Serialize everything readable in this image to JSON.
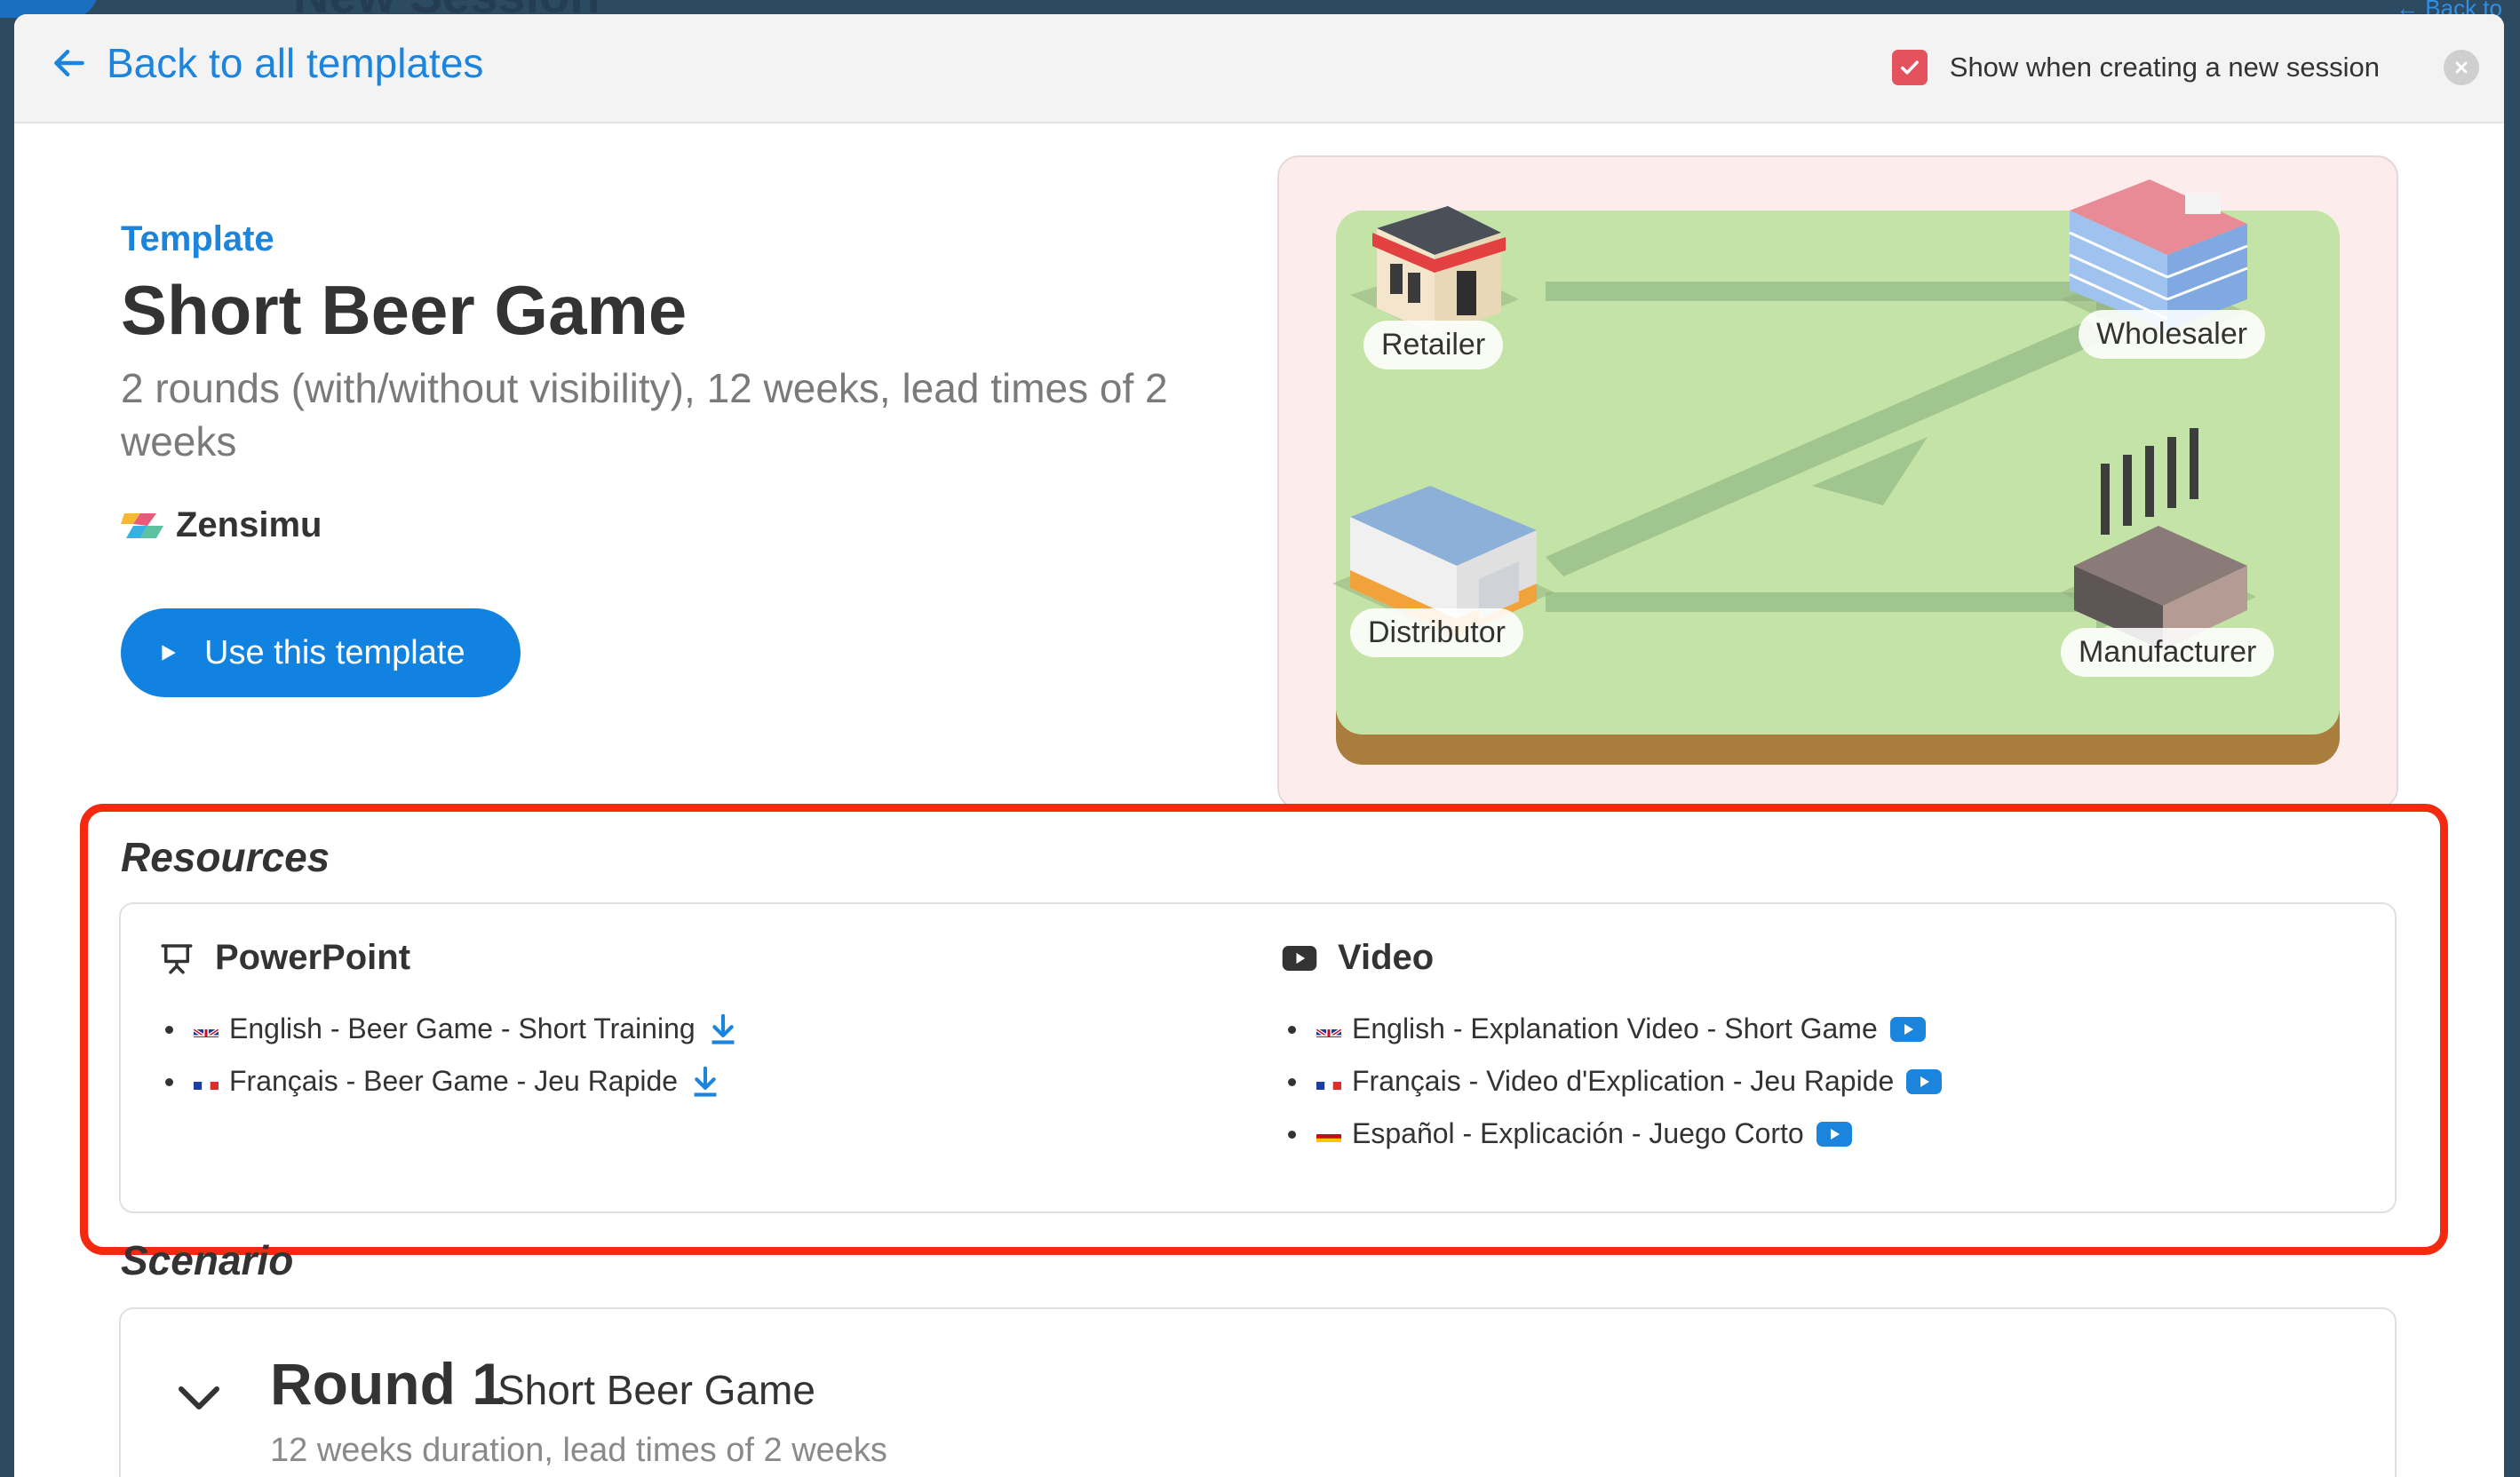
{
  "background": {
    "title": "New Session",
    "back_text": "← Back to"
  },
  "header": {
    "back_label": "Back to all templates",
    "show_toggle_label": "Show when creating a new session",
    "show_toggle_checked": true
  },
  "template": {
    "kicker": "Template",
    "title": "Short Beer Game",
    "description": "2 rounds (with/without visibility), 12 weeks, lead times of 2 weeks",
    "author": "Zensimu",
    "use_button_label": "Use this template"
  },
  "illustration": {
    "nodes": [
      {
        "label": "Retailer"
      },
      {
        "label": "Wholesaler"
      },
      {
        "label": "Distributor"
      },
      {
        "label": "Manufacturer"
      }
    ]
  },
  "resources": {
    "heading": "Resources",
    "powerpoint": {
      "title": "PowerPoint",
      "items": [
        {
          "lang": "English",
          "flag": "gb",
          "text": "English - Beer Game - Short Training",
          "action_icon": "download-icon"
        },
        {
          "lang": "Français",
          "flag": "fr",
          "text": "Français - Beer Game - Jeu Rapide",
          "action_icon": "download-icon"
        }
      ]
    },
    "video": {
      "title": "Video",
      "items": [
        {
          "lang": "English",
          "flag": "gb",
          "text": "English - Explanation Video - Short Game",
          "action_icon": "youtube-icon"
        },
        {
          "lang": "Français",
          "flag": "fr",
          "text": "Français - Video d'Explication - Jeu Rapide",
          "action_icon": "youtube-icon"
        },
        {
          "lang": "Español",
          "flag": "es",
          "text": "Español - Explicación - Juego Corto",
          "action_icon": "youtube-icon"
        }
      ]
    }
  },
  "scenario": {
    "heading": "Scenario",
    "rounds": [
      {
        "title": "Round 1",
        "name": "Short Beer Game",
        "description": "12 weeks duration, lead times of 2 weeks"
      }
    ]
  },
  "colors": {
    "accent": "#1282e0",
    "link": "#1b84dd",
    "checkbox": "#e4525e",
    "highlight": "#f42a10",
    "ground": "#c4e3a6",
    "illustration_bg": "#fdecec"
  }
}
